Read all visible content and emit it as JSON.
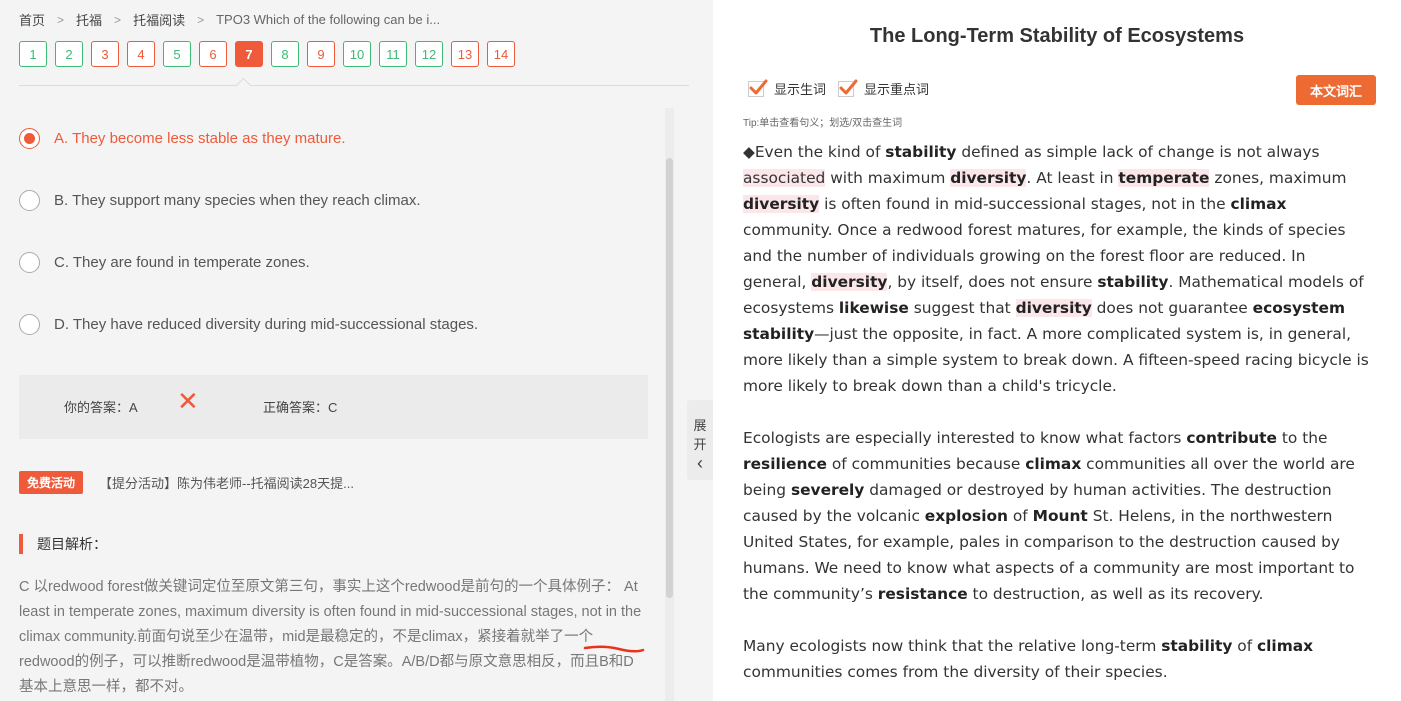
{
  "breadcrumb": {
    "home": "首页",
    "cat": "托福",
    "sub": "托福阅读",
    "current": "TPO3 Which of the following can be i..."
  },
  "questions": [
    {
      "n": "1",
      "state": "correct"
    },
    {
      "n": "2",
      "state": "correct"
    },
    {
      "n": "3",
      "state": "wrong"
    },
    {
      "n": "4",
      "state": "wrong"
    },
    {
      "n": "5",
      "state": "correct"
    },
    {
      "n": "6",
      "state": "wrong"
    },
    {
      "n": "7",
      "state": "active"
    },
    {
      "n": "8",
      "state": "correct"
    },
    {
      "n": "9",
      "state": "wrong"
    },
    {
      "n": "10",
      "state": "correct"
    },
    {
      "n": "11",
      "state": "correct"
    },
    {
      "n": "12",
      "state": "correct"
    },
    {
      "n": "13",
      "state": "wrong"
    },
    {
      "n": "14",
      "state": "wrong"
    }
  ],
  "options": [
    {
      "text": "A. They become less stable as they mature.",
      "selected": true
    },
    {
      "text": "B. They support many species when they reach climax.",
      "selected": false
    },
    {
      "text": "C. They are found in temperate zones.",
      "selected": false
    },
    {
      "text": "D. They have reduced diversity during mid-successional stages.",
      "selected": false
    }
  ],
  "answer": {
    "yours": "你的答案：A",
    "cross": "✕",
    "correct": "正确答案：C"
  },
  "activity": {
    "badge": "免费活动",
    "text": "【提分活动】陈为伟老师--托福阅读28天提..."
  },
  "analysis": {
    "title": "题目解析：",
    "text": "C 以redwood forest做关键词定位至原文第三句，事实上这个redwood是前句的一个具体例子： At least in temperate zones, maximum diversity is often found in mid-successional stages, not in the climax community.前面句说至少在温带，mid是最稳定的，不是climax，紧接着就举了一个redwood的例子，可以推断redwood是温带植物，C是答案。A/B/D都与原文意思相反，而且B和D基本上意思一样，都不对。"
  },
  "expand_tab": {
    "c1": "展",
    "c2": "开",
    "arrow": "‹"
  },
  "passage_header": {
    "title": "The Long-Term Stability of Ecosystems",
    "check_new": "显示生词",
    "check_key": "显示重点词",
    "vocab_button": "本文词汇",
    "tip": "Tip:单击查看句义；划选/双击查生词"
  },
  "passage": {
    "paragraphs": [
      [
        [
          "t",
          "◆Even the kind of "
        ],
        [
          "b",
          "stability"
        ],
        [
          "t",
          " defined as simple lack of change is not always "
        ],
        [
          "h",
          "associated"
        ],
        [
          "t",
          " with maximum "
        ],
        [
          "bh",
          "diversity"
        ],
        [
          "t",
          ". At least in "
        ],
        [
          "bh",
          "temperate"
        ],
        [
          "t",
          " zones, maximum "
        ],
        [
          "bh",
          "diversity"
        ],
        [
          "t",
          " is often found in mid-successional stages, not in the "
        ],
        [
          "b",
          "climax"
        ],
        [
          "t",
          " community. Once a redwood forest matures, for example, the kinds of species and the number of individuals growing on the forest floor are reduced. In general, "
        ],
        [
          "bh",
          "diversity"
        ],
        [
          "t",
          ", by itself, does not ensure "
        ],
        [
          "b",
          "stability"
        ],
        [
          "t",
          ". Mathematical models of ecosystems "
        ],
        [
          "b",
          "likewise"
        ],
        [
          "t",
          " suggest that "
        ],
        [
          "bh",
          "diversity"
        ],
        [
          "t",
          " does not guarantee "
        ],
        [
          "b",
          "ecosystem stability"
        ],
        [
          "t",
          "—just the opposite, in fact. A more complicated system is, in general, more likely than a simple system to break down. A fifteen-speed racing bicycle is more likely to break down than a child's tricycle."
        ]
      ],
      [
        [
          "t",
          "Ecologists are especially interested to know what factors "
        ],
        [
          "b",
          "contribute"
        ],
        [
          "t",
          " to the "
        ],
        [
          "b",
          "resilience"
        ],
        [
          "t",
          " of communities because "
        ],
        [
          "b",
          "climax"
        ],
        [
          "t",
          " communities all over the world are being "
        ],
        [
          "b",
          "severely"
        ],
        [
          "t",
          " damaged or destroyed by human activities. The destruction caused by the volcanic "
        ],
        [
          "b",
          "explosion"
        ],
        [
          "t",
          " of "
        ],
        [
          "b",
          "Mount"
        ],
        [
          "t",
          " St. Helens, in the northwestern United States, for example, pales in comparison to the destruction caused by humans. We need to know what aspects of a community are most important to the community’s "
        ],
        [
          "b",
          "resistance"
        ],
        [
          "t",
          " to destruction, as well as its recovery."
        ]
      ],
      [
        [
          "t",
          "Many ecologists now think that the relative long-term "
        ],
        [
          "b",
          "stability"
        ],
        [
          "t",
          " of "
        ],
        [
          "b",
          "climax"
        ],
        [
          "t",
          " communities comes from the diversity of their species."
        ]
      ]
    ]
  },
  "colors": {
    "accent": "#ee5a3a",
    "correct_green": "#3dba75",
    "vocab_button": "#ee6a33",
    "highlight": "#fbe6ea"
  }
}
